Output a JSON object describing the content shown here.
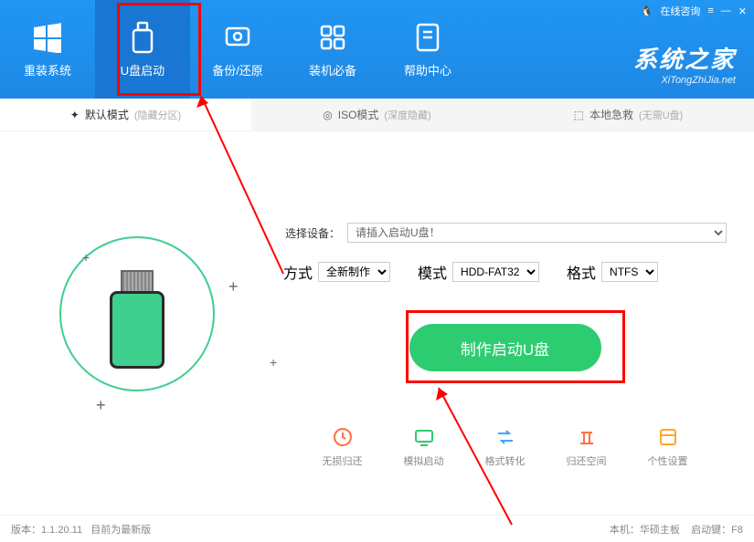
{
  "titlebar": {
    "consult": "在线咨询"
  },
  "nav": {
    "items": [
      {
        "label": "重装系统"
      },
      {
        "label": "U盘启动"
      },
      {
        "label": "备份/还原"
      },
      {
        "label": "装机必备"
      },
      {
        "label": "帮助中心"
      }
    ]
  },
  "logo": {
    "main": "系统之家",
    "sub": "XiTongZhiJia.net"
  },
  "tabs": {
    "items": [
      {
        "label": "默认模式",
        "hint": "(隐藏分区)"
      },
      {
        "label": "ISO模式",
        "hint": "(深度隐藏)"
      },
      {
        "label": "本地急救",
        "hint": "(无需U盘)"
      }
    ]
  },
  "form": {
    "device_label": "选择设备：",
    "device_placeholder": "请插入启动U盘！",
    "method_label": "方式",
    "method_value": "全新制作",
    "mode_label": "模式",
    "mode_value": "HDD-FAT32",
    "format_label": "格式",
    "format_value": "NTFS"
  },
  "create_button": "制作启动U盘",
  "tools": {
    "items": [
      {
        "label": "无损归还",
        "color": "#ff7043"
      },
      {
        "label": "模拟启动",
        "color": "#2ecc71"
      },
      {
        "label": "格式转化",
        "color": "#42a5f5"
      },
      {
        "label": "归还空间",
        "color": "#ff7043"
      },
      {
        "label": "个性设置",
        "color": "#ffa726"
      }
    ]
  },
  "footer": {
    "version_label": "版本：",
    "version": "1.1.20.11",
    "version_status": "目前为最新版",
    "machine_label": "本机：",
    "machine": "华硕主板",
    "bootkey_label": "启动键：",
    "bootkey": "F8"
  }
}
